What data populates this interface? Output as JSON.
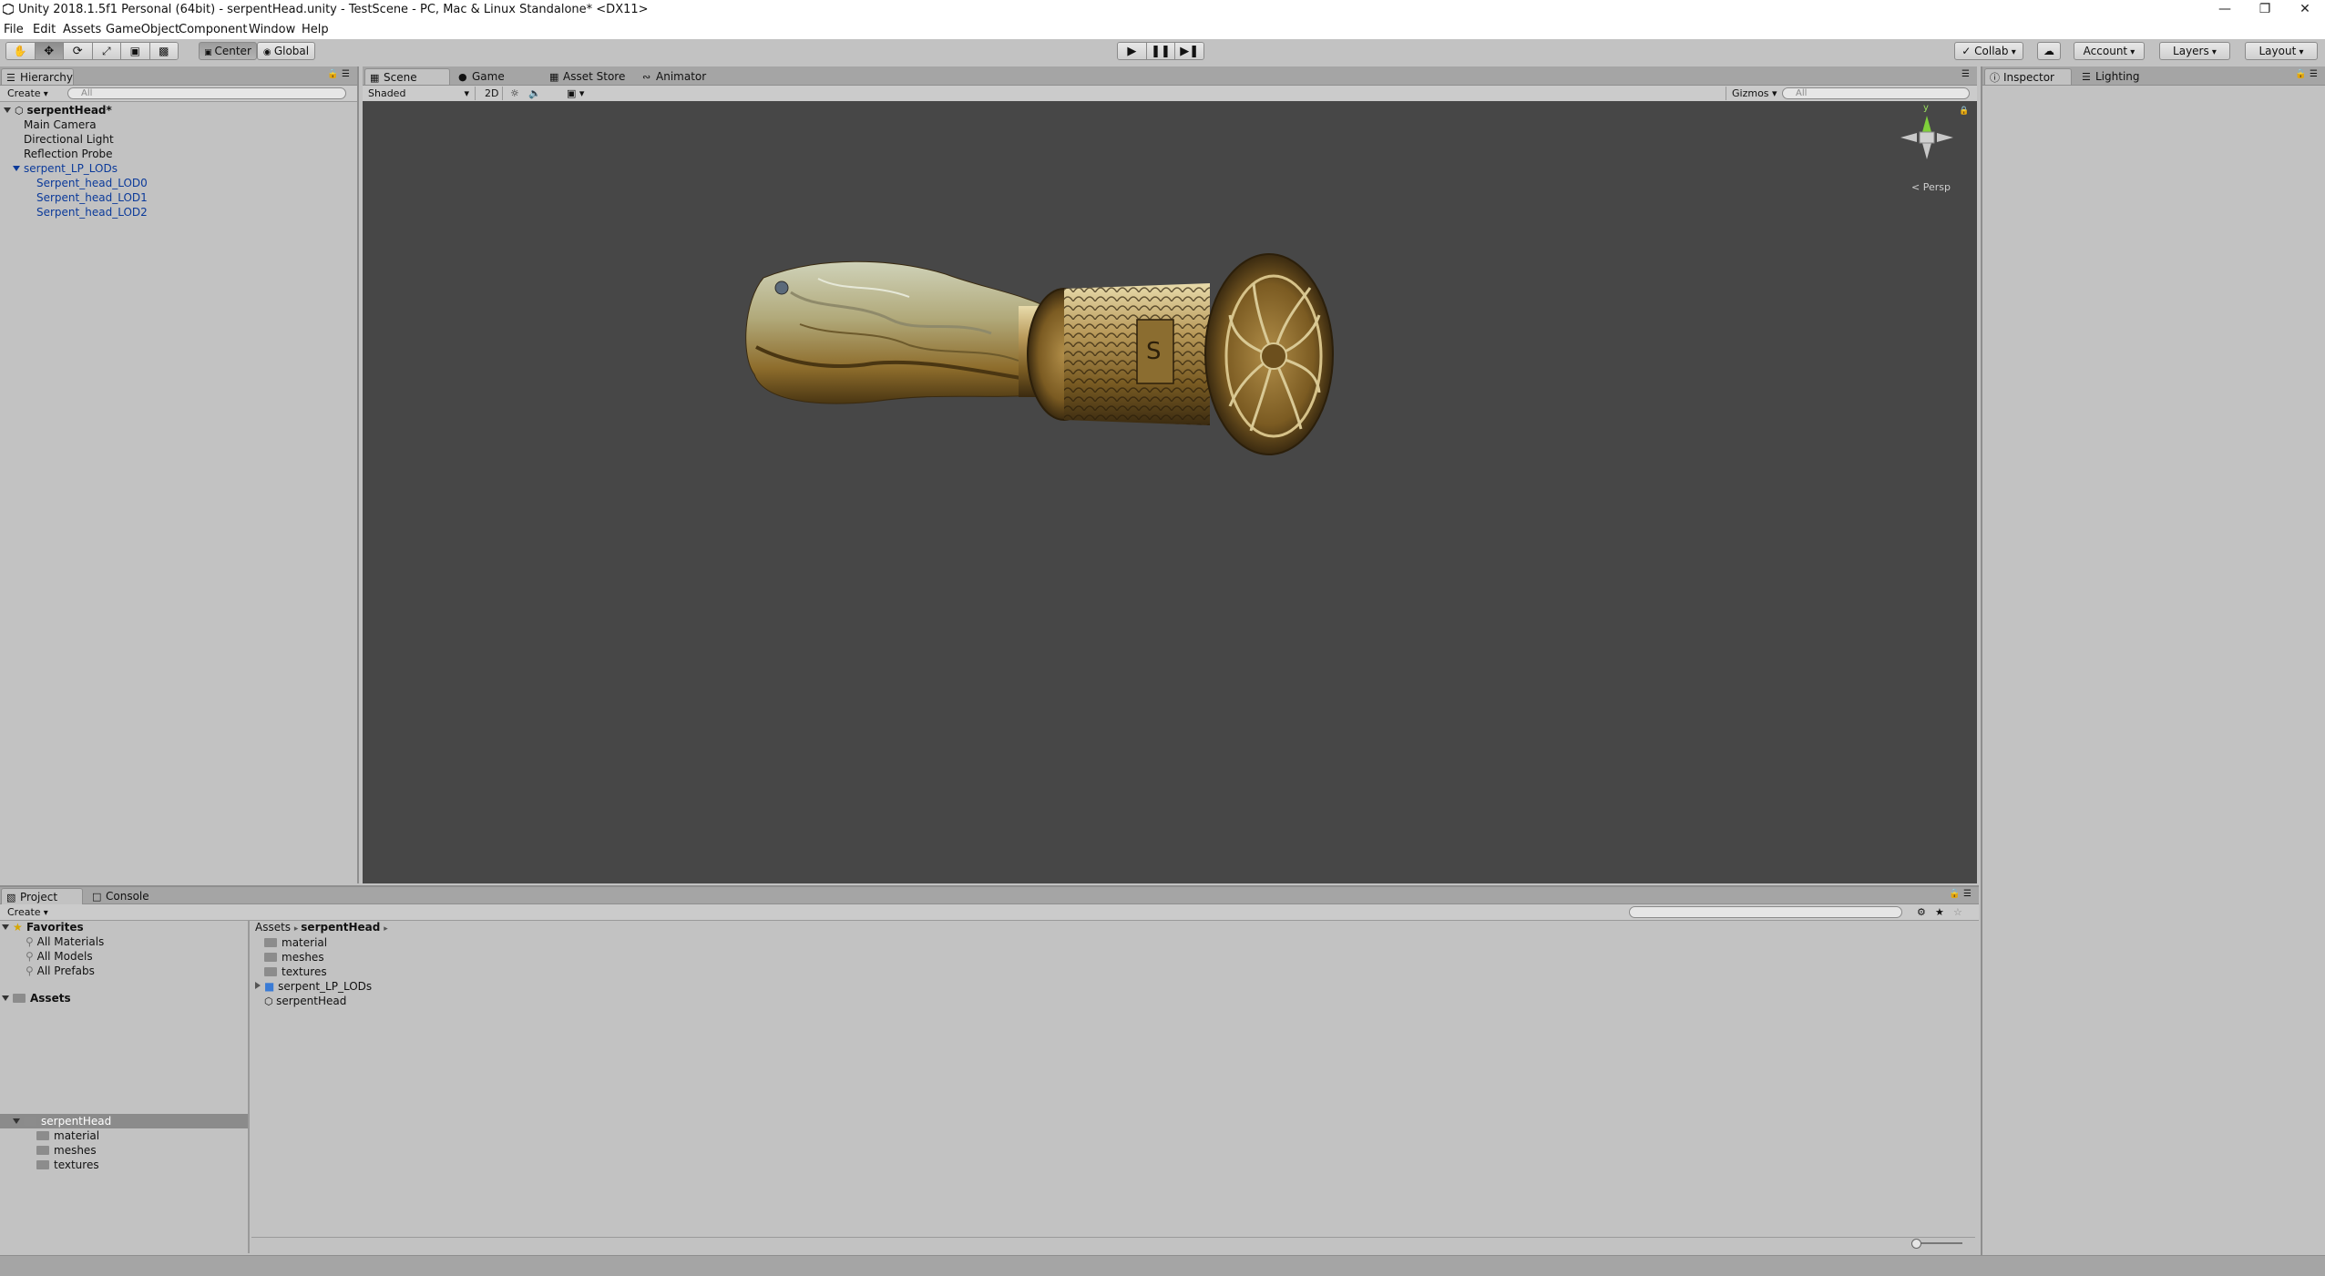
{
  "window": {
    "title": "Unity 2018.1.5f1 Personal (64bit) - serpentHead.unity - TestScene - PC, Mac & Linux Standalone* <DX11>",
    "controls": [
      "—",
      "❐",
      "✕"
    ]
  },
  "menu": [
    "File",
    "Edit",
    "Assets",
    "GameObject",
    "Component",
    "Window",
    "Help"
  ],
  "toolbar": {
    "pivot": "Center",
    "space": "Global",
    "collab": "Collab",
    "account": "Account",
    "layers": "Layers",
    "layout": "Layout"
  },
  "hierarchy": {
    "tab": "Hierarchy",
    "create": "Create",
    "search_placeholder": "All",
    "scene": "serpentHead*",
    "items": [
      "Main Camera",
      "Directional Light",
      "Reflection Probe",
      "serpent_LP_LODs",
      "Serpent_head_LOD0",
      "Serpent_head_LOD1",
      "Serpent_head_LOD2"
    ]
  },
  "scene_view": {
    "tabs": [
      "Scene",
      "Game",
      "Asset Store",
      "Animator"
    ],
    "shading": "Shaded",
    "mode_2d": "2D",
    "gizmos": "Gizmos",
    "search_placeholder": "All",
    "axis_y": "y",
    "projection": "Persp",
    "background_color": "#474747"
  },
  "inspector": {
    "tabs": [
      "Inspector",
      "Lighting"
    ]
  },
  "project": {
    "tabs": [
      "Project",
      "Console"
    ],
    "create": "Create",
    "favorites_label": "Favorites",
    "favorites": [
      "All Materials",
      "All Models",
      "All Prefabs"
    ],
    "assets_label": "Assets",
    "tree_root": "serpentHead",
    "tree_children": [
      "material",
      "meshes",
      "textures"
    ],
    "breadcrumb": [
      "Assets",
      "serpentHead"
    ],
    "files": [
      "material",
      "meshes",
      "textures",
      "serpent_LP_LODs",
      "serpentHead"
    ]
  }
}
